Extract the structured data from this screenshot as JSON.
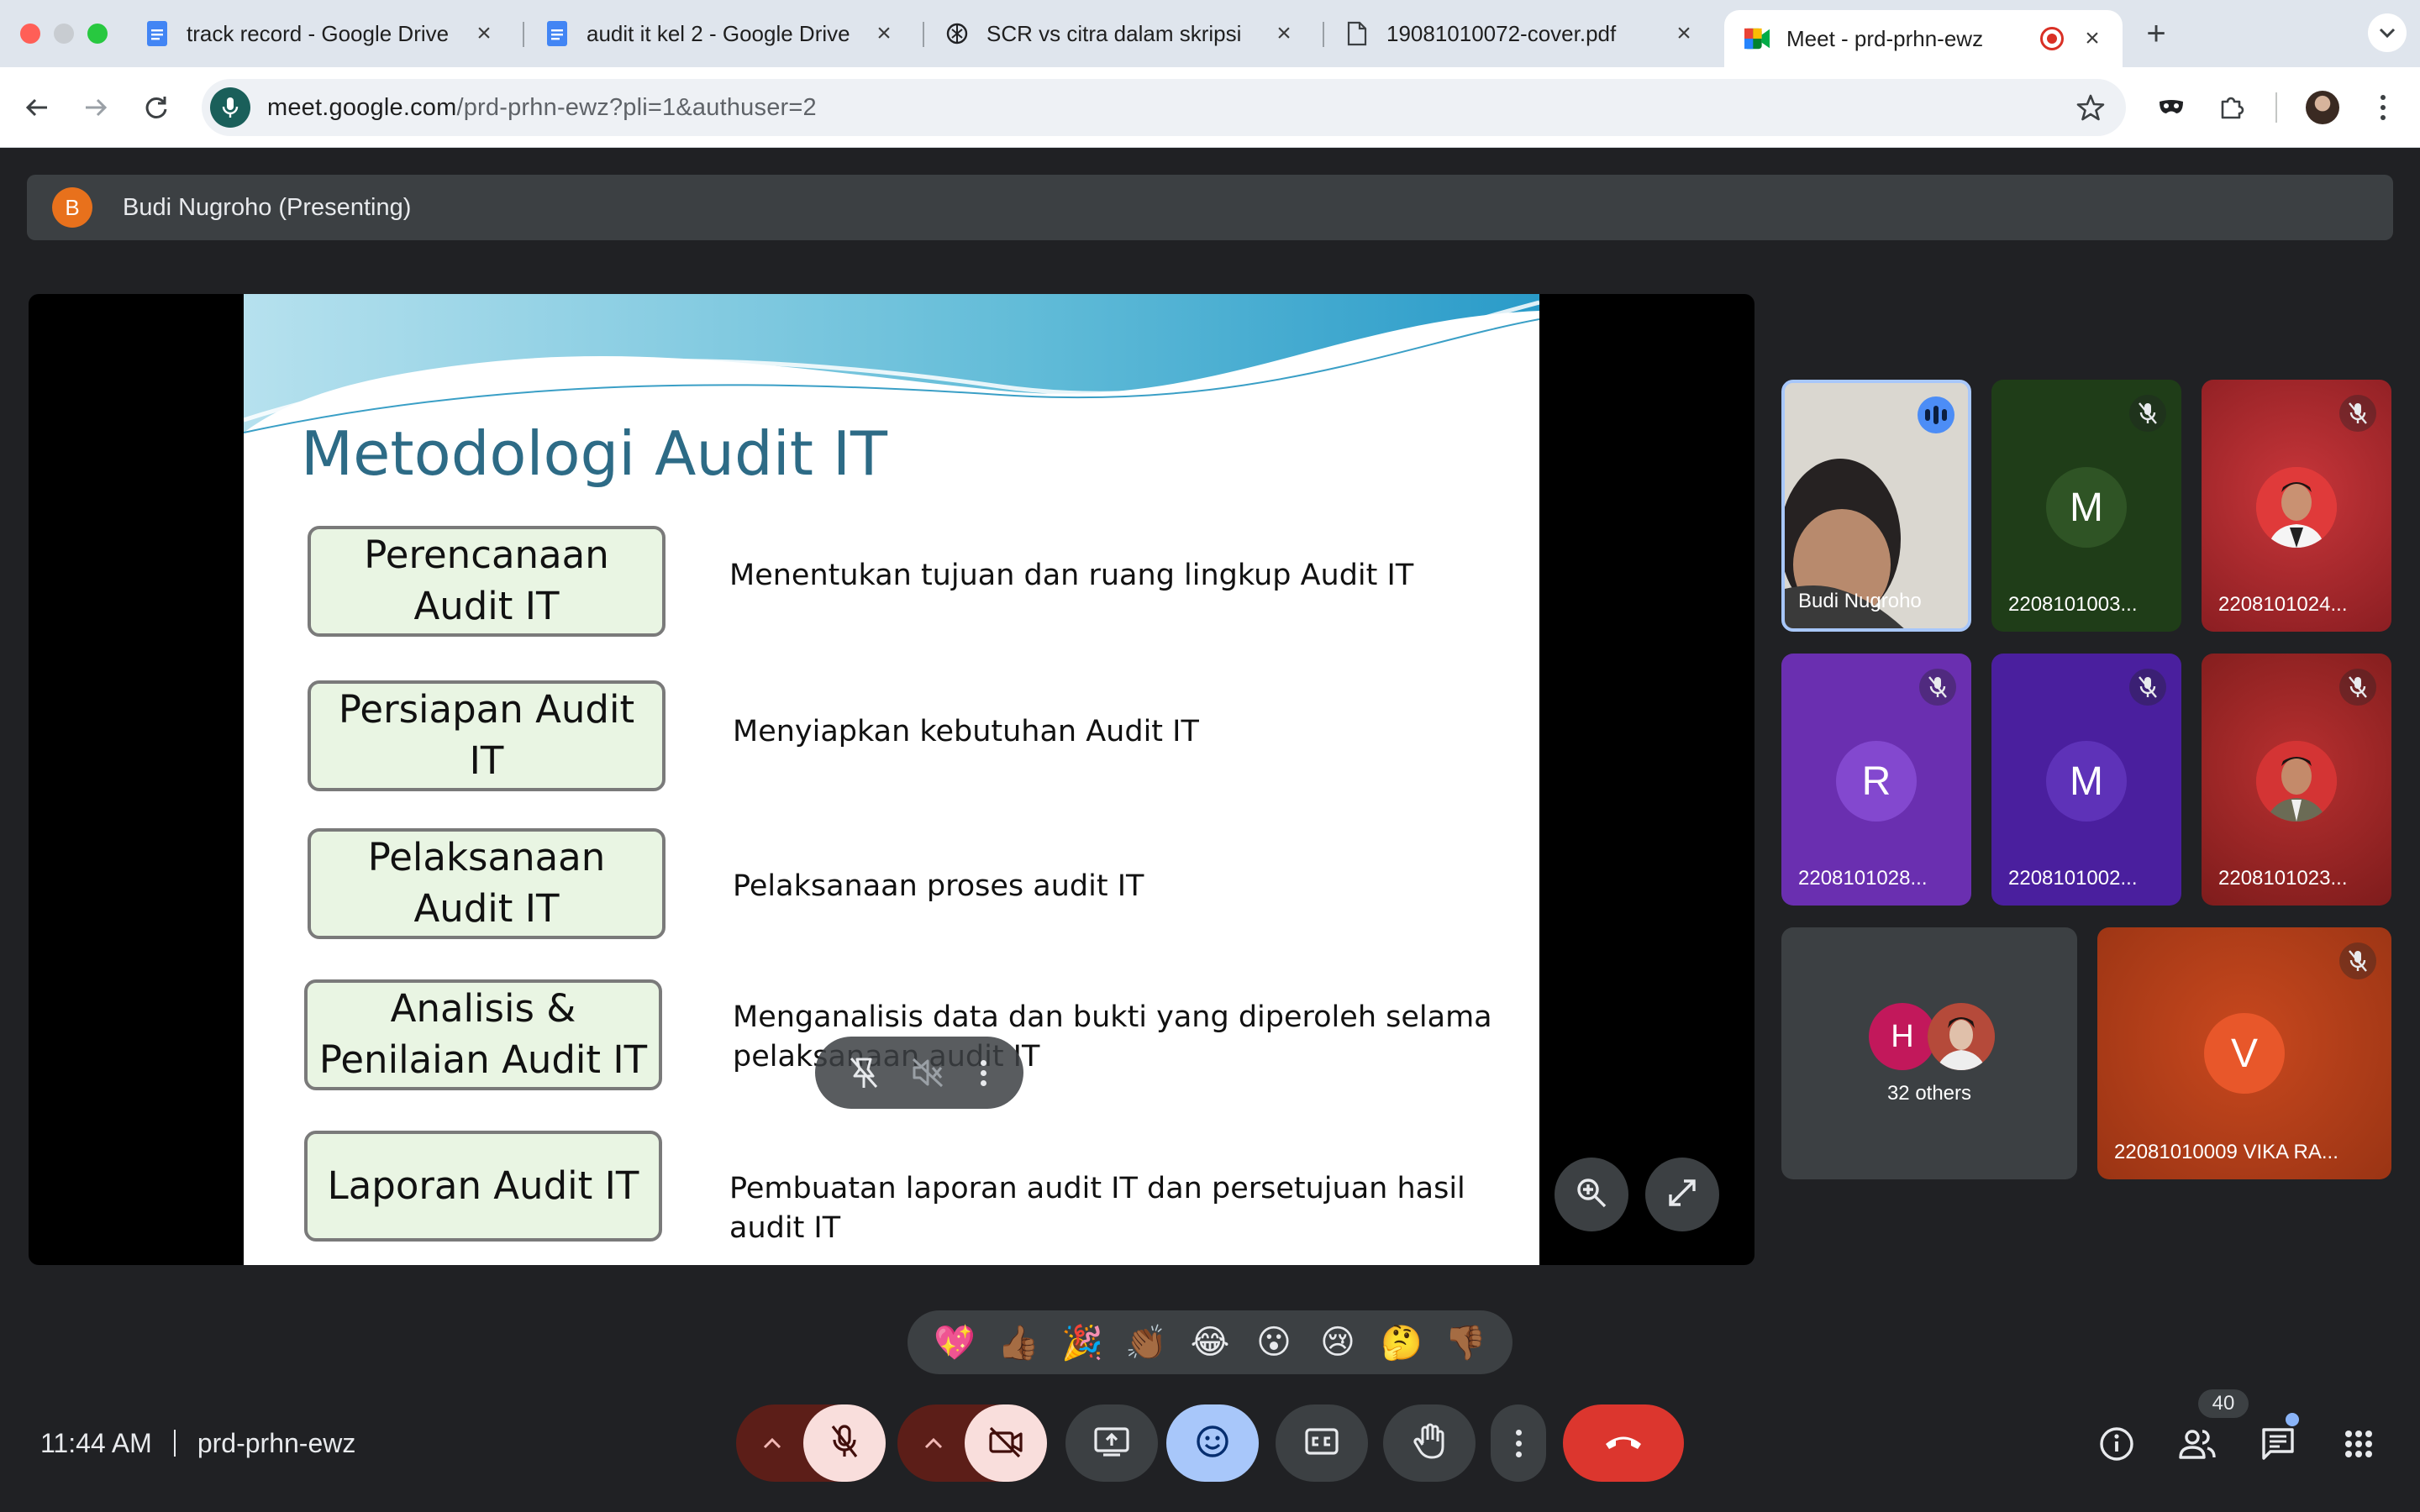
{
  "browser": {
    "tabs": [
      {
        "title": "track record - Google Drive",
        "icon": "google-docs-icon"
      },
      {
        "title": "audit it kel 2 - Google Drive",
        "icon": "google-docs-icon"
      },
      {
        "title": "SCR vs citra dalam skripsi",
        "icon": "chatgpt-icon"
      },
      {
        "title": "19081010072-cover.pdf",
        "icon": "document-icon"
      },
      {
        "title": "Meet - prd-prhn-ewz",
        "icon": "google-meet-icon",
        "active": true
      }
    ],
    "url_host": "meet.google.com",
    "url_rest": "/prd-prhn-ewz?pli=1&authuser=2"
  },
  "meet": {
    "presenter": {
      "initial": "B",
      "label": "Budi Nugroho (Presenting)"
    },
    "slide": {
      "title": "Metodologi Audit IT",
      "steps": [
        {
          "label": "Perencanaan\nAudit IT",
          "desc": "Menentukan tujuan dan ruang lingkup Audit IT"
        },
        {
          "label": "Persiapan Audit IT",
          "desc": "Menyiapkan kebutuhan Audit IT"
        },
        {
          "label": "Pelaksanaan\nAudit IT",
          "desc": "Pelaksanaan proses audit IT"
        },
        {
          "label": "Analisis &\nPenilaian Audit IT",
          "desc": "Menganalisis data dan bukti yang diperoleh selama\npelaksanaan audit IT"
        },
        {
          "label": "Laporan Audit IT",
          "desc": "Pembuatan laporan audit IT dan persetujuan hasil audit IT"
        }
      ]
    },
    "participants": [
      {
        "name": "Budi Nugroho",
        "speaking": true
      },
      {
        "name": "2208101003...",
        "initial": "M",
        "color": "#1e3b16"
      },
      {
        "name": "2208101024...",
        "color": "#b02a2a"
      },
      {
        "name": "2208101028...",
        "initial": "R",
        "color": "#6d2fb5"
      },
      {
        "name": "2208101002...",
        "initial": "M",
        "color": "#4a1f9e"
      },
      {
        "name": "2208101023...",
        "color": "#b02a2a"
      },
      {
        "name": "22081010009 VIKA RA...",
        "initial": "V",
        "color": "#c2431b"
      }
    ],
    "others": {
      "initial": "H",
      "label": "32 others"
    },
    "reactions": [
      "💖",
      "👍🏾",
      "🎉",
      "👏🏾",
      "😂",
      "😮",
      "😢",
      "🤔",
      "👎🏾"
    ],
    "time": "11:44 AM",
    "meeting_code": "prd-prhn-ewz",
    "participant_count": "40"
  }
}
